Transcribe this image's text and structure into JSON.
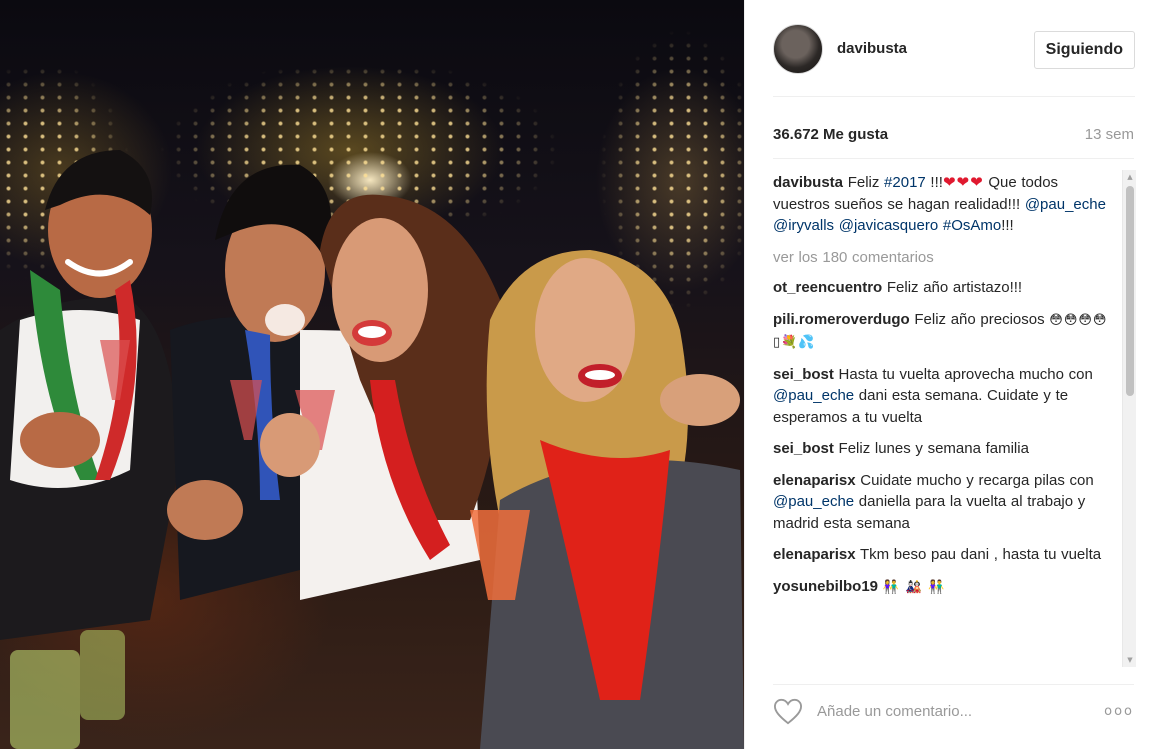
{
  "post": {
    "photo": {
      "alt": "group photo"
    },
    "header": {
      "username": "davibusta",
      "follow_label": "Siguiendo"
    },
    "meta": {
      "likes": "36.672 Me gusta",
      "time": "13 sem"
    },
    "caption": {
      "author": "davibusta",
      "parts": [
        "Feliz ",
        "#2017",
        " !!!",
        "❤❤❤",
        " Que todos vuestros sueños se hagan realidad!!! ",
        "@pau_eche",
        " ",
        "@iryvalls",
        " ",
        "@javicasquero",
        " ",
        "#OsAmo",
        "!!!"
      ]
    },
    "view_all": "ver los 180 comentarios",
    "comments": [
      {
        "author": "ot_reencuentro",
        "text": "Feliz año artistazo!!!"
      },
      {
        "author": "pili.romeroverdugo",
        "text": "Feliz año preciosos",
        "emoji": "😳😳😳😳▯💐💦"
      },
      {
        "author": "sei_bost",
        "parts": [
          "Hasta tu vuelta aprovecha mucho con ",
          "@pau_eche",
          " dani esta semana. Cuidate y te esperamos a tu vuelta"
        ]
      },
      {
        "author": "sei_bost",
        "text": "Feliz lunes y semana familia"
      },
      {
        "author": "elenaparisx",
        "parts": [
          "Cuidate mucho y recarga pilas con ",
          "@pau_eche",
          " daniella para la vuelta al trabajo y madrid esta semana"
        ]
      },
      {
        "author": "elenaparisx",
        "text": "Tkm beso pau dani , hasta tu vuelta"
      },
      {
        "author": "yosunebilbo19",
        "emoji": "👫 🎎 👫"
      }
    ],
    "footer": {
      "placeholder": "Añade un comentario...",
      "more": "ooo"
    },
    "colors": {
      "link": "#003569",
      "muted": "#999999",
      "text": "#262626",
      "heart": "#e0192f"
    }
  }
}
